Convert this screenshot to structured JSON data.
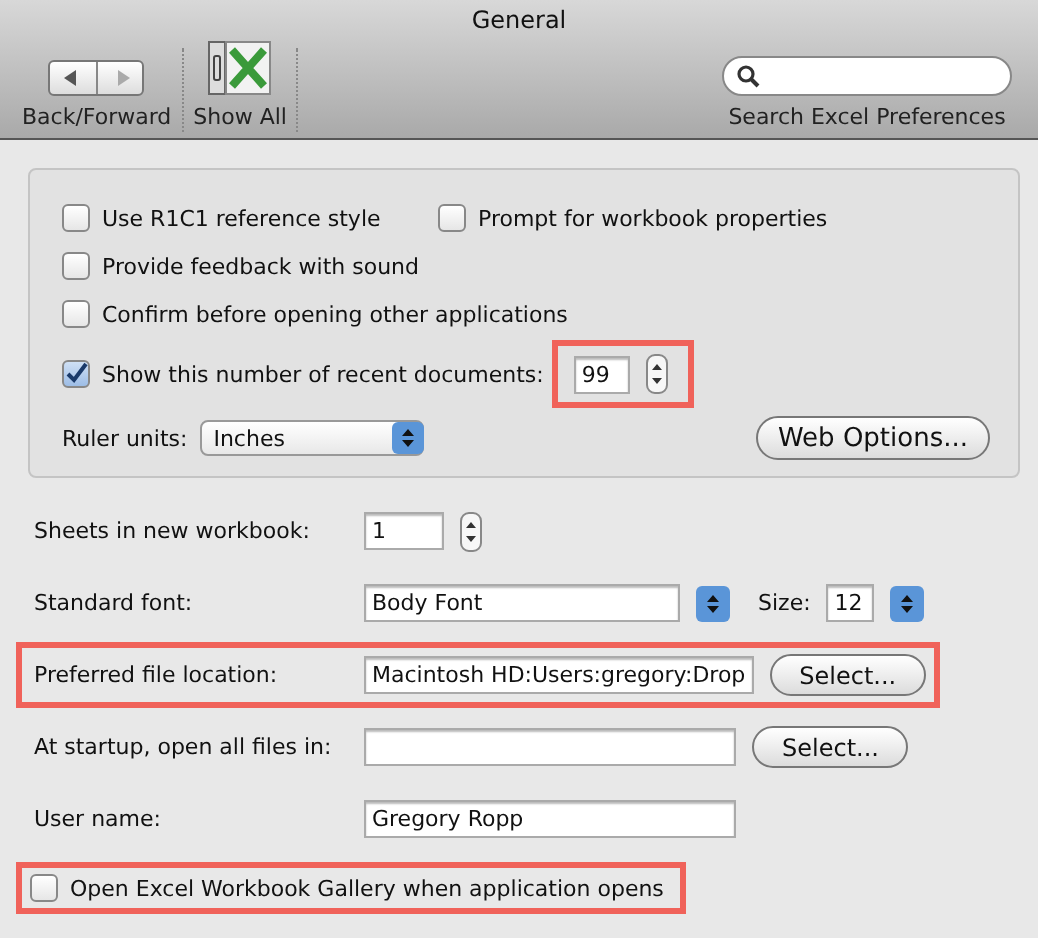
{
  "window": {
    "title": "General"
  },
  "toolbar": {
    "back_forward_label": "Back/Forward",
    "show_all_label": "Show All",
    "search_label": "Search Excel Preferences"
  },
  "options": {
    "checkboxes": [
      {
        "label": "Use R1C1 reference style",
        "checked": false
      },
      {
        "label": "Prompt for workbook properties",
        "checked": false
      },
      {
        "label": "Provide feedback with sound",
        "checked": false
      },
      {
        "label": "Confirm before opening other applications",
        "checked": false
      }
    ],
    "recent": {
      "label": "Show this number of recent documents:",
      "checked": true,
      "value": "99",
      "highlighted": true
    },
    "ruler": {
      "label": "Ruler units:",
      "value": "Inches"
    },
    "web_options": "Web Options..."
  },
  "settings": [
    {
      "kind": "stepper",
      "label": "Sheets in new workbook:",
      "value": "1",
      "highlighted": false
    },
    {
      "kind": "font",
      "label": "Standard font:",
      "value": "Body Font",
      "size_label": "Size:",
      "size": "12",
      "highlighted": false
    },
    {
      "kind": "path",
      "label": "Preferred file location:",
      "value": "Macintosh HD:Users:gregory:Drop",
      "button": "Select...",
      "highlighted": true
    },
    {
      "kind": "path",
      "label": "At startup, open all files in:",
      "button": "Select...",
      "highlighted": false
    },
    {
      "kind": "text",
      "label": "User name:",
      "value": "Gregory Ropp",
      "highlighted": false
    }
  ],
  "gallery": {
    "label": "Open Excel Workbook Gallery when application opens",
    "checked": false,
    "highlighted": true
  }
}
